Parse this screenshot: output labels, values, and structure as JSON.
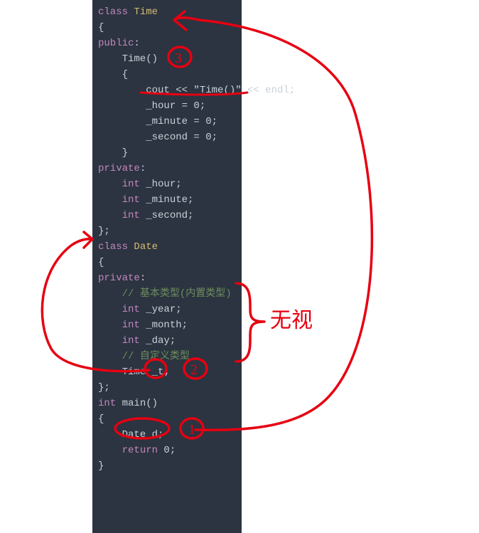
{
  "code": {
    "lines": [
      "class Time",
      "{",
      "public:",
      "    Time()",
      "    {",
      "        cout << \"Time()\" << endl;",
      "        _hour = 0;",
      "        _minute = 0;",
      "        _second = 0;",
      "    }",
      "private:",
      "    int _hour;",
      "    int _minute;",
      "    int _second;",
      "};",
      "class Date",
      "{",
      "private:",
      "    // 基本类型(内置类型)",
      "    int _year;",
      "    int _month;",
      "    int _day;",
      "    // 自定义类型",
      "    Time _t;",
      "};",
      "int main()",
      "{",
      "    Date d;",
      "    return 0;",
      "}"
    ],
    "comment1": "基本类型(内置类型)",
    "comment2": "自定义类型"
  },
  "annotations": {
    "side_note": "无视",
    "circle_numbers": [
      "3",
      "2",
      "1"
    ]
  },
  "colors": {
    "background": "#2b3440",
    "foreground": "#c9d1d9",
    "ink": "#e60012"
  }
}
